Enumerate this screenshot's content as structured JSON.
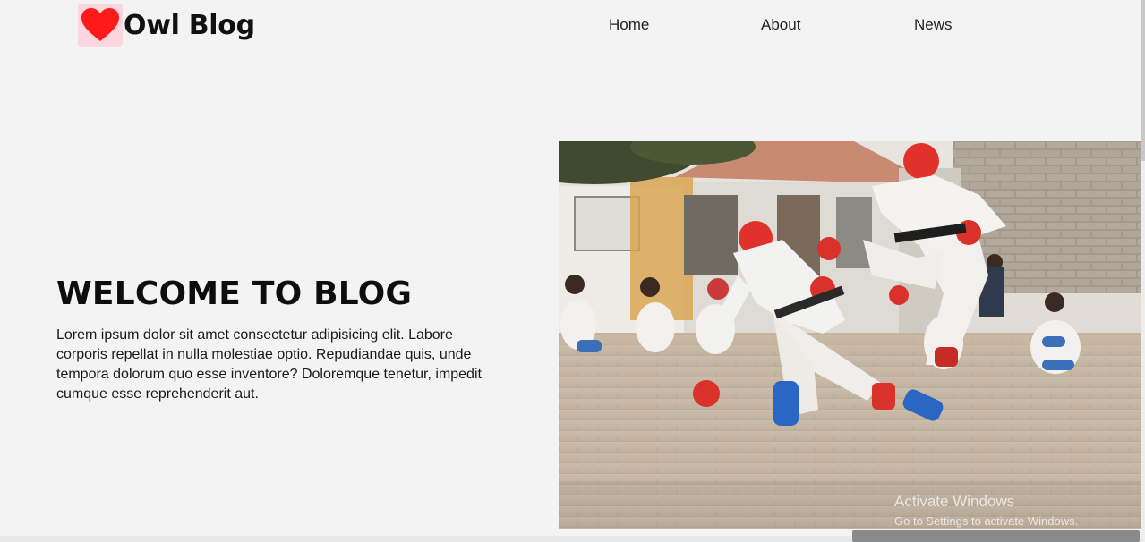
{
  "brand": {
    "title": "Owl Blog",
    "icon": "heart-icon",
    "icon_color": "#ff1a1a"
  },
  "nav": {
    "items": [
      {
        "label": "Home"
      },
      {
        "label": "About"
      },
      {
        "label": "News"
      }
    ]
  },
  "hero": {
    "title": "WELCOME TO BLOG",
    "text": "Lorem ipsum dolor sit amet consectetur adipisicing elit. Labore corporis repellat in nulla molestiae optio. Repudiandae quis, unde tempora dolorum quo esse inventore? Doloremque tenetur, impedit cumque esse reprehenderit aut.",
    "image_subject": "taekwondo-sparring-photo"
  },
  "overlay": {
    "title": "Activate Windows",
    "subtitle": "Go to Settings to activate Windows."
  }
}
